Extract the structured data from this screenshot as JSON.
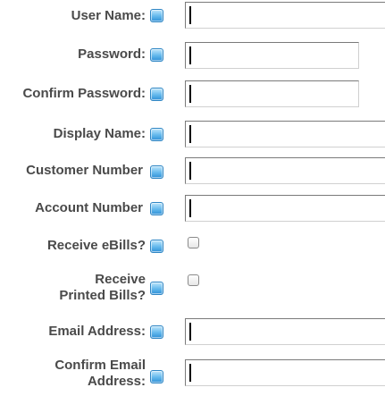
{
  "form": {
    "fields": [
      {
        "label": "User Name:",
        "type": "text"
      },
      {
        "label": "Password:",
        "type": "password"
      },
      {
        "label": "Confirm Password:",
        "type": "password"
      },
      {
        "label": "Display Name:",
        "type": "text"
      },
      {
        "label": "Customer Number",
        "type": "text"
      },
      {
        "label": "Account Number",
        "type": "text"
      },
      {
        "label": "Receive eBills?",
        "type": "checkbox"
      },
      {
        "label": "Receive Printed Bills?",
        "type": "checkbox"
      },
      {
        "label": "Email Address:",
        "type": "text"
      },
      {
        "label": "Confirm Email Address:",
        "type": "text"
      }
    ]
  },
  "icons": {
    "help": "help-icon"
  },
  "colors": {
    "label_text": "#4a4a4a",
    "help_icon_blue": "#4aa8e8"
  }
}
